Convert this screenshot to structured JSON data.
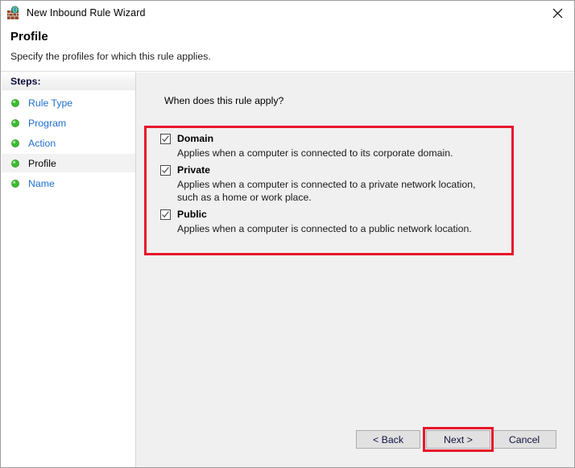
{
  "window": {
    "title": "New Inbound Rule Wizard",
    "icon": "firewall-brick-globe-icon",
    "close_label": "✕"
  },
  "header": {
    "title": "Profile",
    "subtitle": "Specify the profiles for which this rule applies."
  },
  "sidebar": {
    "heading": "Steps:",
    "items": [
      {
        "label": "Rule Type",
        "current": false
      },
      {
        "label": "Program",
        "current": false
      },
      {
        "label": "Action",
        "current": false
      },
      {
        "label": "Profile",
        "current": true
      },
      {
        "label": "Name",
        "current": false
      }
    ]
  },
  "main": {
    "question": "When does this rule apply?",
    "profiles": [
      {
        "name": "Domain",
        "description": "Applies when a computer is connected to its corporate domain.",
        "checked": true
      },
      {
        "name": "Private",
        "description": "Applies when a computer is connected to a private network location, such as a home or work place.",
        "checked": true
      },
      {
        "name": "Public",
        "description": "Applies when a computer is connected to a public network location.",
        "checked": true
      }
    ]
  },
  "footer": {
    "back_label": "< Back",
    "next_label": "Next >",
    "cancel_label": "Cancel"
  },
  "highlights": {
    "color": "#e8152a",
    "targets": [
      "profile-checkbox-group",
      "next-button"
    ]
  }
}
